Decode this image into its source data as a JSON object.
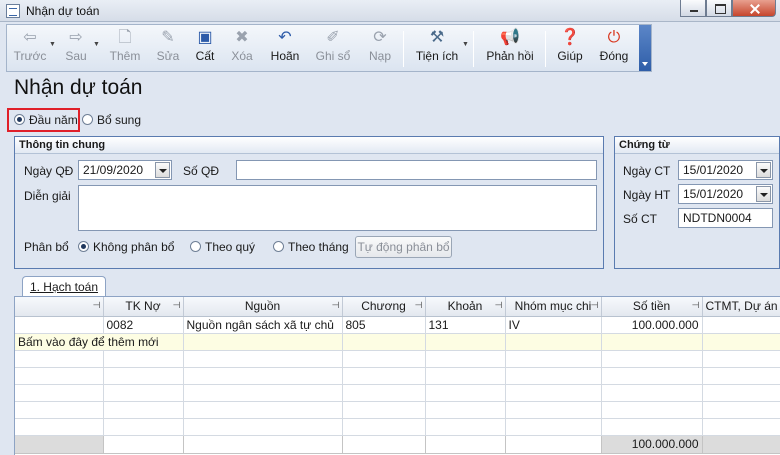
{
  "window": {
    "title": "Nhận dự toán"
  },
  "toolbar": {
    "buttons": [
      {
        "label": "Trước",
        "icon": "arrow-left-icon",
        "enabled": false
      },
      {
        "label": "Sau",
        "icon": "arrow-right-icon",
        "enabled": false
      },
      {
        "label": "Thêm",
        "icon": "add-document-icon",
        "enabled": false
      },
      {
        "label": "Sửa",
        "icon": "edit-document-icon",
        "enabled": false
      },
      {
        "label": "Cất",
        "icon": "save-icon",
        "enabled": true
      },
      {
        "label": "Xóa",
        "icon": "delete-document-icon",
        "enabled": false
      },
      {
        "label": "Hoãn",
        "icon": "undo-icon",
        "enabled": true
      },
      {
        "label": "Ghi sổ",
        "icon": "post-ledger-icon",
        "enabled": false
      },
      {
        "label": "Nạp",
        "icon": "reload-icon",
        "enabled": false
      },
      {
        "label": "Tiện ích",
        "icon": "tools-icon",
        "enabled": true
      },
      {
        "label": "Phản hồi",
        "icon": "megaphone-icon",
        "enabled": true
      },
      {
        "label": "Giúp",
        "icon": "help-icon",
        "enabled": true
      },
      {
        "label": "Đóng",
        "icon": "power-icon",
        "enabled": true
      }
    ]
  },
  "page_title": "Nhận dự toán",
  "type_options": [
    {
      "label": "Đầu năm",
      "selected": true
    },
    {
      "label": "Bổ sung",
      "selected": false
    }
  ],
  "general": {
    "header": "Thông tin chung",
    "date_label": "Ngày QĐ",
    "date_value": "21/09/2020",
    "number_label": "Số QĐ",
    "number_value": "",
    "description_label": "Diễn giải",
    "description_value": "",
    "allocation_label": "Phân bổ",
    "allocation_options": [
      {
        "label": "Không phân bổ",
        "selected": true
      },
      {
        "label": "Theo quý",
        "selected": false
      },
      {
        "label": "Theo tháng",
        "selected": false
      }
    ],
    "auto_allocate_label": "Tự động phân bổ"
  },
  "voucher": {
    "header": "Chứng từ",
    "ct_date_label": "Ngày CT",
    "ct_date_value": "15/01/2020",
    "ht_date_label": "Ngày HT",
    "ht_date_value": "15/01/2020",
    "number_label": "Số CT",
    "number_value": "NDTDN0004"
  },
  "tab": {
    "label": "1. Hạch toán"
  },
  "grid": {
    "columns": [
      "",
      "TK Nợ",
      "Nguồn",
      "Chương",
      "Khoản",
      "Nhóm mục chi",
      "Số tiền",
      "CTMT, Dự án"
    ],
    "rows": [
      [
        "",
        "0082",
        "Nguồn ngân sách xã tự chủ",
        "805",
        "131",
        "IV",
        "100.000.000",
        ""
      ]
    ],
    "add_row_text": "Bấm vào đây để thêm mới",
    "total_amount": "100.000.000"
  },
  "colors": {
    "accent": "#2f5ea8",
    "highlight_box": "#e0202a",
    "new_row_bg": "#fdfde3"
  }
}
